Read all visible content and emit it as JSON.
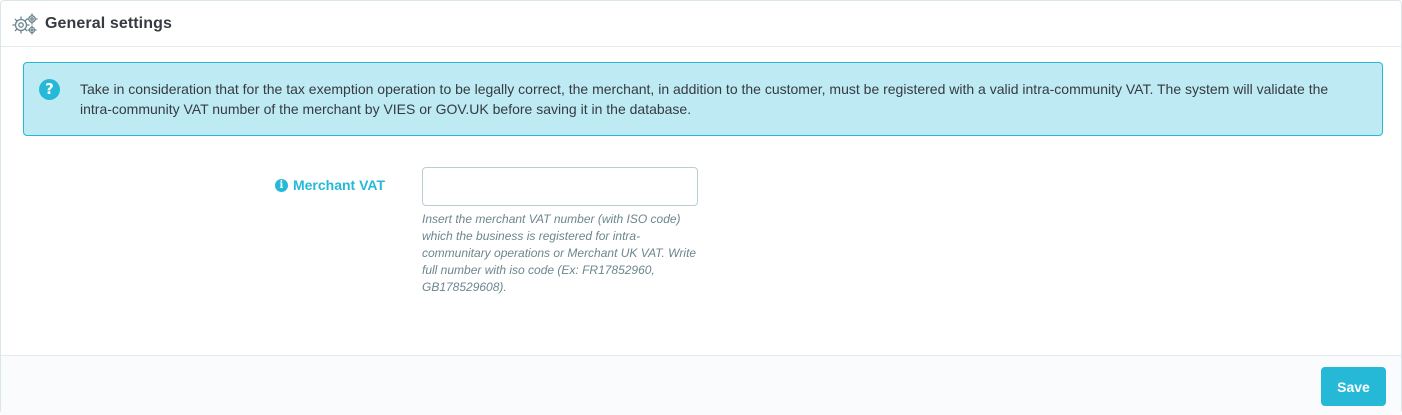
{
  "header": {
    "title": "General settings",
    "icon": "cogs-icon"
  },
  "alert": {
    "icon": "question-circle-icon",
    "icon_glyph": "?",
    "text": "Take in consideration that for the tax exemption operation to be legally correct, the merchant, in addition to the customer, must be registered with a valid intra-community VAT. The system will validate the intra-community VAT number of the merchant by VIES or GOV.UK before saving it in the database."
  },
  "form": {
    "merchant_vat": {
      "icon": "info-circle-icon",
      "icon_glyph": "i",
      "label": "Merchant VAT",
      "value": "",
      "help": "Insert the merchant VAT number (with ISO code) which the business is registered for intra-communitary operations or Merchant UK VAT. Write full number with iso code (Ex: FR17852960, GB178529608)."
    }
  },
  "footer": {
    "save_label": "Save"
  },
  "colors": {
    "accent": "#25b9d7",
    "alert_bg": "#beeaf3",
    "text": "#363a41",
    "help_text": "#6c868e"
  }
}
